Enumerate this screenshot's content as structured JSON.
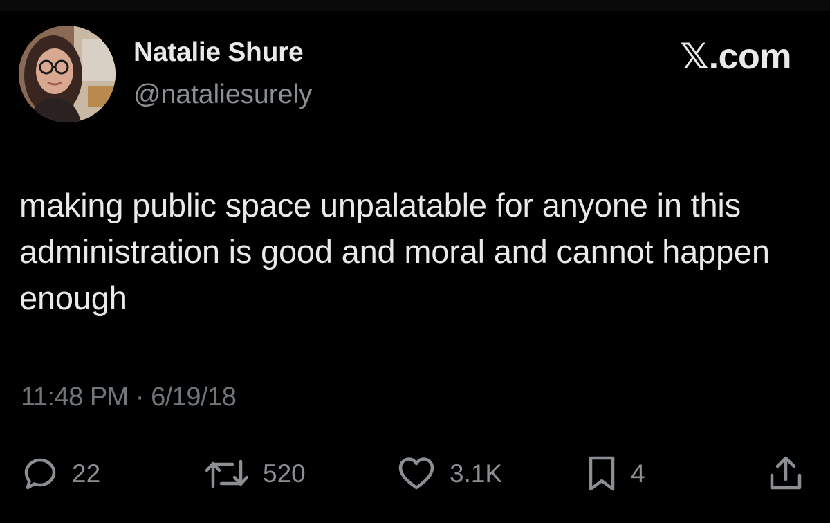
{
  "tweet": {
    "display_name": "Natalie Shure",
    "handle": "@nataliesurely",
    "brand": "𝕏.com",
    "text": "making public space unpalatable for anyone in this administration is good and moral and cannot happen enough",
    "timestamp": "11:48 PM · 6/19/18"
  },
  "actions": {
    "reply": {
      "icon": "reply-icon",
      "count": "22"
    },
    "repost": {
      "icon": "repost-icon",
      "count": "520"
    },
    "like": {
      "icon": "heart-icon",
      "count": "3.1K"
    },
    "bookmark": {
      "icon": "bookmark-icon",
      "count": "4"
    },
    "share": {
      "icon": "share-icon"
    }
  },
  "colors": {
    "background": "#000000",
    "text_primary": "#e7e9ea",
    "text_secondary": "#8b8f94",
    "icon": "#8b8f94"
  }
}
